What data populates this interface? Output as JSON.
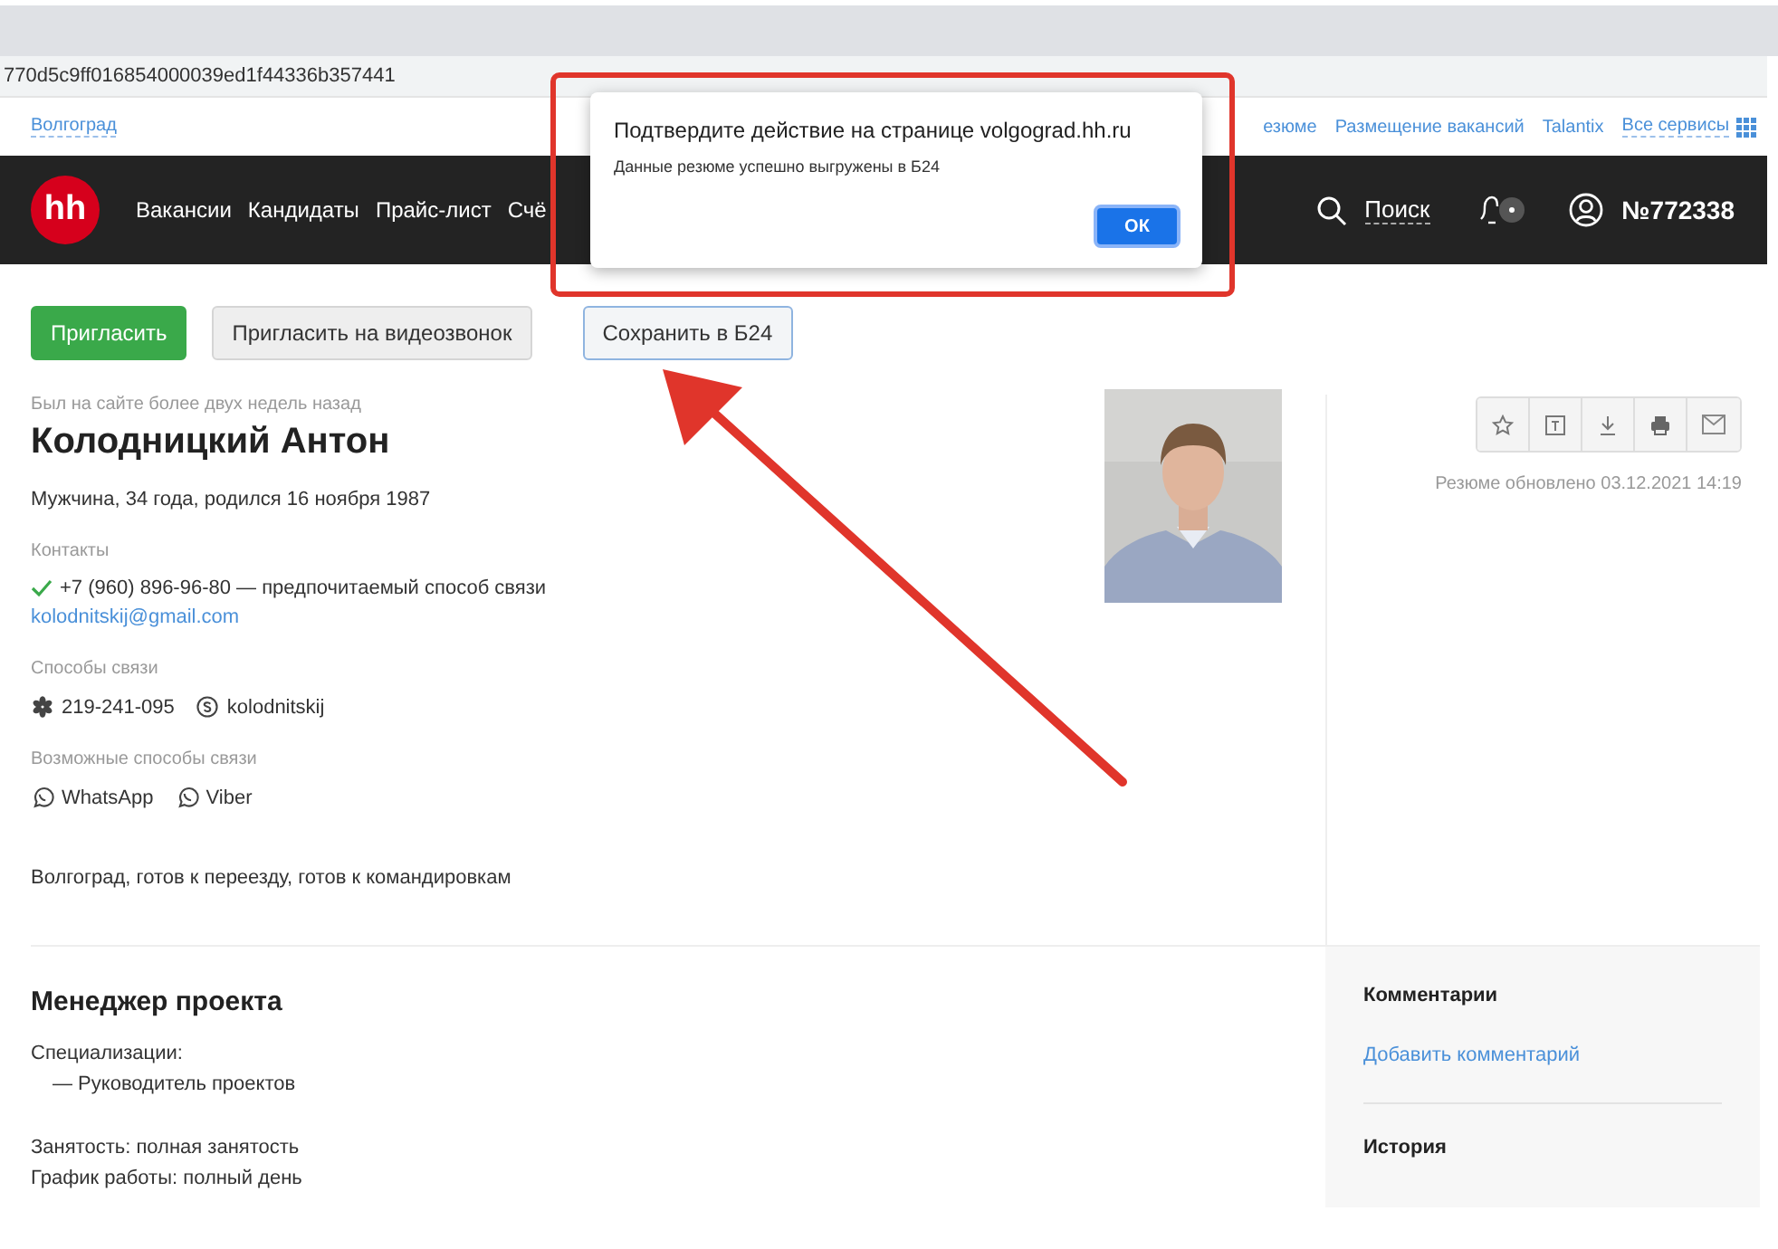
{
  "browser": {
    "url": "770d5c9ff016854000039ed1f44336b357441"
  },
  "top_links": {
    "city": "Волгоград",
    "links": [
      "езюме",
      "Размещение вакансий",
      "Talantix",
      "Все сервисы"
    ]
  },
  "nav": {
    "logo": "hh",
    "items": [
      "Вакансии",
      "Кандидаты",
      "Прайс-лист",
      "Счё"
    ],
    "search": "Поиск",
    "account": "№772338"
  },
  "actions": [
    {
      "label": "Пригласить",
      "kind": "primary"
    },
    {
      "label": "Пригласить на видеозвонок",
      "kind": "secondary"
    },
    {
      "label": "Сохранить в Б24",
      "kind": "outline"
    }
  ],
  "profile": {
    "last_seen": "Был на сайте более двух недель назад",
    "name": "Колодницкий Антон",
    "info": "Мужчина, 34 года, родился 16 ноября 1987",
    "contacts_label": "Контакты",
    "phone": {
      "number": "+7 (960) 896-96-80",
      "note": "— предпочитаемый способ связи",
      "verified": true
    },
    "email": "kolodnitskij@gmail.com",
    "channels_label": "Способы связи",
    "channels": [
      {
        "kind": "icq",
        "text": "219-241-095"
      },
      {
        "kind": "skype",
        "text": "kolodnitskij"
      }
    ],
    "possible_label": "Возможные способы связи",
    "possible": [
      {
        "kind": "whatsapp",
        "text": "WhatsApp"
      },
      {
        "kind": "viber",
        "text": "Viber"
      }
    ],
    "location": "Волгоград, готов к переезду, готов к командировкам"
  },
  "updated": "Резюме обновлено 03.12.2021 14:19",
  "position": {
    "title": "Менеджер проекта",
    "spec_label": "Специализации:",
    "spec": "— Руководитель проектов",
    "employment": "Занятость: полная занятость",
    "schedule": "График работы: полный день"
  },
  "sidebar": {
    "comments_title": "Комментарии",
    "add_comment": "Добавить комментарий",
    "history_title": "История"
  },
  "dialog": {
    "title": "Подтвердите действие на странице volgograd.hh.ru",
    "message": "Данные резюме успешно выгружены в Б24",
    "button": "ОК"
  }
}
